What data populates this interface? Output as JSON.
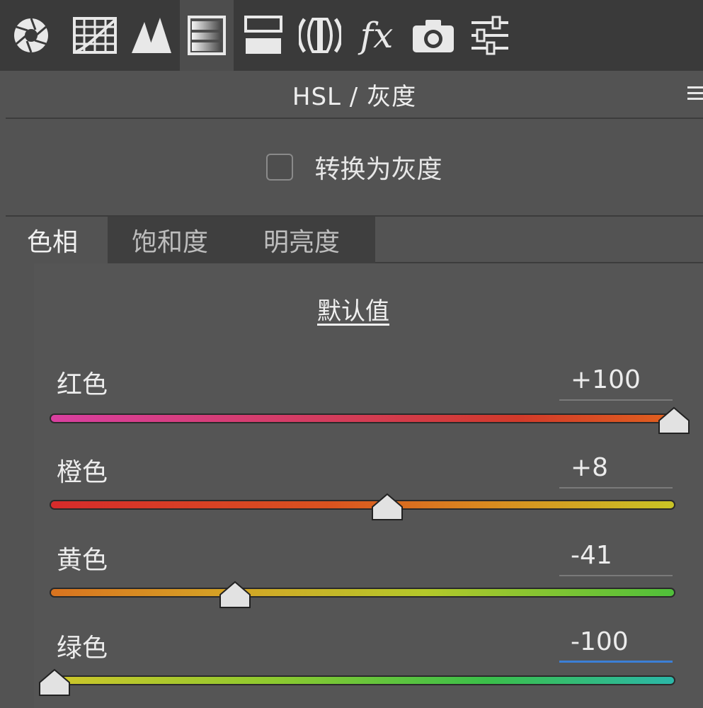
{
  "toolbar": {
    "tools": [
      {
        "icon": "aperture-icon"
      },
      {
        "icon": "grid-curve-icon"
      },
      {
        "icon": "mountains-icon"
      },
      {
        "icon": "hsl-gradient-icon",
        "active": true
      },
      {
        "icon": "split-tone-icon"
      },
      {
        "icon": "lens-icon"
      },
      {
        "icon": "fx-icon",
        "text": "fx"
      },
      {
        "icon": "camera-icon"
      },
      {
        "icon": "sliders-icon"
      }
    ]
  },
  "panel": {
    "title": "HSL / 灰度",
    "menu_icon": "menu-icon"
  },
  "grayscale": {
    "label": "转换为灰度",
    "checked": false
  },
  "tabs": [
    {
      "label": "色相",
      "active": true
    },
    {
      "label": "饱和度",
      "active": false
    },
    {
      "label": "明亮度",
      "active": false
    }
  ],
  "default_label": "默认值",
  "sliders": [
    {
      "label": "红色",
      "value": "+100",
      "level": 100,
      "focused": false
    },
    {
      "label": "橙色",
      "value": "+8",
      "level": 8,
      "focused": false
    },
    {
      "label": "黄色",
      "value": "-41",
      "level": -41,
      "focused": false
    },
    {
      "label": "绿色",
      "value": "-100",
      "level": -100,
      "focused": true
    }
  ],
  "colors": {
    "toolbar_bg": "#3a3a3a",
    "panel_bg": "#535353",
    "focus_blue": "#3b7fd6"
  }
}
